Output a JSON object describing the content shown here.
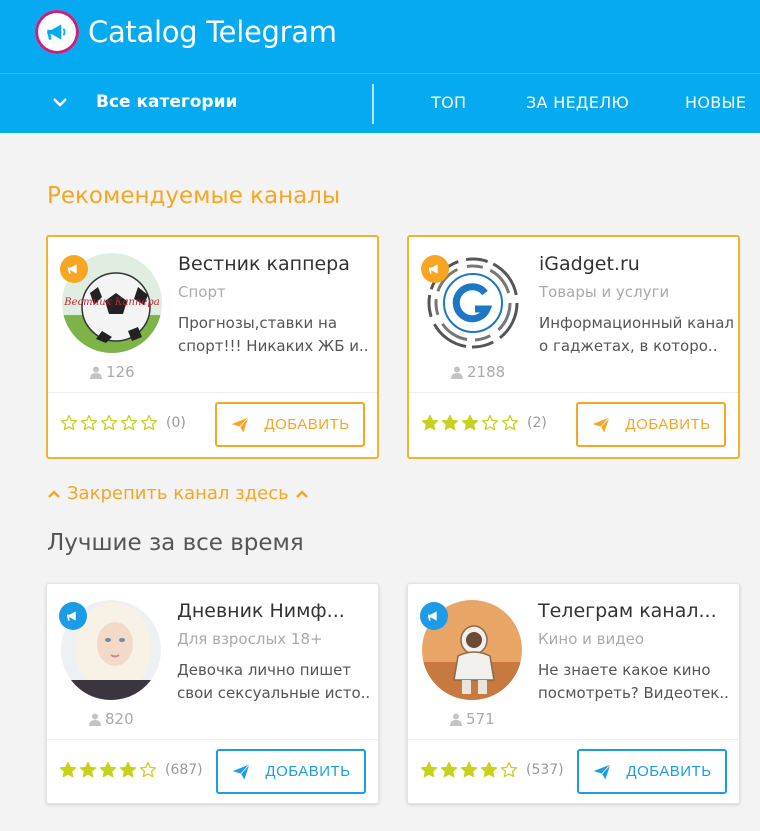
{
  "header": {
    "site_title": "Catalog Telegram",
    "category_select": "Все категории",
    "nav": [
      "ТОП",
      "ЗА НЕДЕЛЮ",
      "НОВЫЕ"
    ]
  },
  "recommended": {
    "title": "Рекомендуемые каналы",
    "cards": [
      {
        "title": "Вестник каппера",
        "category": "Спорт",
        "description": "Прогнозы,ставки на спорт!!! Никаких ЖБ и..",
        "subscribers": "126",
        "rating_stars": 0,
        "rating_count": "(0)",
        "button": "ДОБАВИТЬ",
        "avatar_caption": "Вестник Каппера"
      },
      {
        "title": "iGadget.ru",
        "category": "Товары и услуги",
        "description": "Информационный канал о гаджетах, в которо..",
        "subscribers": "2188",
        "rating_stars": 3,
        "rating_count": "(2)",
        "button": "ДОБАВИТЬ"
      }
    ]
  },
  "pin_link": "Закрепить канал здесь",
  "best": {
    "title": "Лучшие за все время",
    "cards": [
      {
        "title": "Дневник Нимф...",
        "category": "Для взрослых 18+",
        "description": "Девочка лично пишет свои сексуальные исто..",
        "subscribers": "820",
        "rating_stars": 4,
        "rating_count": "(687)",
        "button": "ДОБАВИТЬ"
      },
      {
        "title": "Телеграм канал...",
        "category": "Кино и видео",
        "description": "Не знаете какое кино посмотреть? Видеотек..",
        "subscribers": "571",
        "rating_stars": 4,
        "rating_count": "(537)",
        "button": "ДОБАВИТЬ"
      }
    ]
  },
  "colors": {
    "header_bg": "#05aaf0",
    "accent_orange": "#f6a623",
    "accent_blue": "#1c9be6",
    "star_filled": "#c6d21b",
    "background": "#f3f3f3"
  },
  "icons": {
    "logo": "megaphone-icon",
    "category_toggle": "chevron-down-icon",
    "badge": "megaphone-icon",
    "subscribers": "user-icon",
    "rating": "star-icon",
    "add": "paper-plane-icon",
    "pin": "chevron-up-icon"
  }
}
